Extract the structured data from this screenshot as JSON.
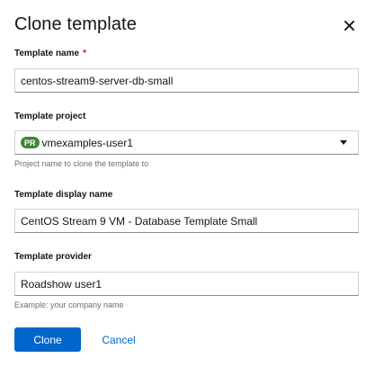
{
  "modal": {
    "title": "Clone template",
    "close_icon": "close-icon"
  },
  "fields": {
    "name": {
      "label": "Template name",
      "required_marker": "*",
      "value": "centos-stream9-server-db-small"
    },
    "project": {
      "label": "Template project",
      "badge": "PR",
      "value": "vmexamples-user1",
      "helper": "Project name to clone the template to",
      "caret_icon": "caret-down-icon"
    },
    "display_name": {
      "label": "Template display name",
      "value": "CentOS Stream 9 VM - Database Template Small"
    },
    "provider": {
      "label": "Template provider",
      "value": "Roadshow user1",
      "helper": "Example: your company name"
    }
  },
  "actions": {
    "clone_label": "Clone",
    "cancel_label": "Cancel"
  },
  "colors": {
    "primary": "#0066cc",
    "badge": "#3e8635",
    "required": "#c9190b"
  }
}
